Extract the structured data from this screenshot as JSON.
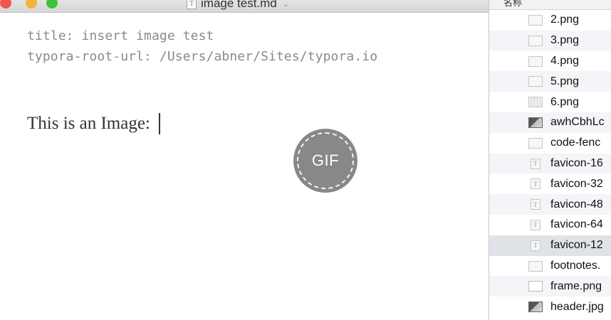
{
  "window": {
    "title": "image test.md",
    "doc_icon_glyph": "T",
    "chevron_glyph": "⌄"
  },
  "editor": {
    "front_matter": [
      "title: insert image test",
      "typora-root-url: /Users/abner/Sites/typora.io"
    ],
    "paragraph": "This is an Image:"
  },
  "overlay": {
    "label": "GIF"
  },
  "finder": {
    "header": "名称",
    "files": [
      {
        "name": "2.png",
        "icon": "image-file-icon"
      },
      {
        "name": "3.png",
        "icon": "image-file-icon"
      },
      {
        "name": "4.png",
        "icon": "image-file-icon"
      },
      {
        "name": "5.png",
        "icon": "image-file-icon"
      },
      {
        "name": "6.png",
        "icon": "image-thumb-icon"
      },
      {
        "name": "awhCbhLc",
        "icon": "image-dark-icon"
      },
      {
        "name": "code-fenc",
        "icon": "image-file-icon"
      },
      {
        "name": "favicon-16",
        "icon": "text-file-icon"
      },
      {
        "name": "favicon-32",
        "icon": "text-file-icon"
      },
      {
        "name": "favicon-48",
        "icon": "text-file-icon"
      },
      {
        "name": "favicon-64",
        "icon": "text-file-icon"
      },
      {
        "name": "favicon-12",
        "icon": "text-file-icon",
        "selected": true
      },
      {
        "name": "footnotes.",
        "icon": "image-file-icon"
      },
      {
        "name": "frame.png",
        "icon": "blank-file-icon"
      },
      {
        "name": "header.jpg",
        "icon": "image-dark-icon"
      }
    ]
  }
}
